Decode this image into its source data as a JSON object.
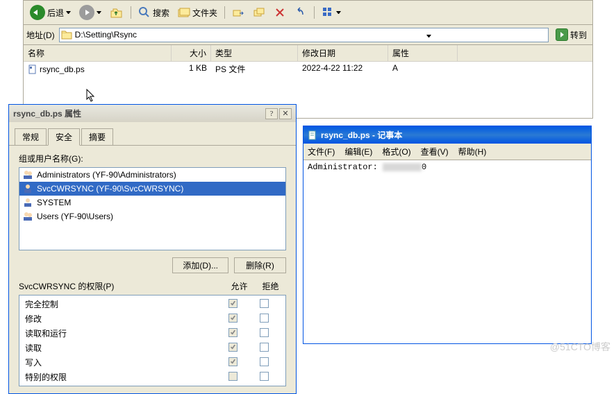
{
  "explorer": {
    "toolbar": {
      "back": "后退",
      "search": "搜索",
      "folders": "文件夹"
    },
    "address": {
      "label": "地址(D)",
      "value": "D:\\Setting\\Rsync",
      "go": "转到"
    },
    "columns": {
      "name": "名称",
      "size": "大小",
      "type": "类型",
      "date": "修改日期",
      "attr": "属性"
    },
    "files": [
      {
        "name": "rsync_db.ps",
        "size": "1 KB",
        "type": "PS 文件",
        "date": "2022-4-22 11:22",
        "attr": "A"
      }
    ]
  },
  "properties": {
    "title": "rsync_db.ps 属性",
    "tabs": {
      "general": "常规",
      "security": "安全",
      "summary": "摘要"
    },
    "group_label": "组或用户名称(G):",
    "users": [
      {
        "label": "Administrators (YF-90\\Administrators)",
        "selected": false
      },
      {
        "label": "SvcCWRSYNC (YF-90\\SvcCWRSYNC)",
        "selected": true
      },
      {
        "label": "SYSTEM",
        "selected": false
      },
      {
        "label": "Users (YF-90\\Users)",
        "selected": false
      }
    ],
    "add_btn": "添加(D)...",
    "remove_btn": "删除(R)",
    "perm_for": "SvcCWRSYNC 的权限(P)",
    "allow": "允许",
    "deny": "拒绝",
    "perms": [
      {
        "name": "完全控制",
        "allow": true,
        "deny": false,
        "gray": true
      },
      {
        "name": "修改",
        "allow": true,
        "deny": false,
        "gray": true
      },
      {
        "name": "读取和运行",
        "allow": true,
        "deny": false,
        "gray": true
      },
      {
        "name": "读取",
        "allow": true,
        "deny": false,
        "gray": true
      },
      {
        "name": "写入",
        "allow": true,
        "deny": false,
        "gray": true
      },
      {
        "name": "特别的权限",
        "allow": false,
        "deny": false,
        "gray": true
      }
    ]
  },
  "notepad": {
    "title": "rsync_db.ps - 记事本",
    "menu": {
      "file": "文件(F)",
      "edit": "编辑(E)",
      "format": "格式(O)",
      "view": "查看(V)",
      "help": "帮助(H)"
    },
    "content_prefix": "Administrator:",
    "content_suffix": "0"
  },
  "watermark": "@51CTO博客"
}
